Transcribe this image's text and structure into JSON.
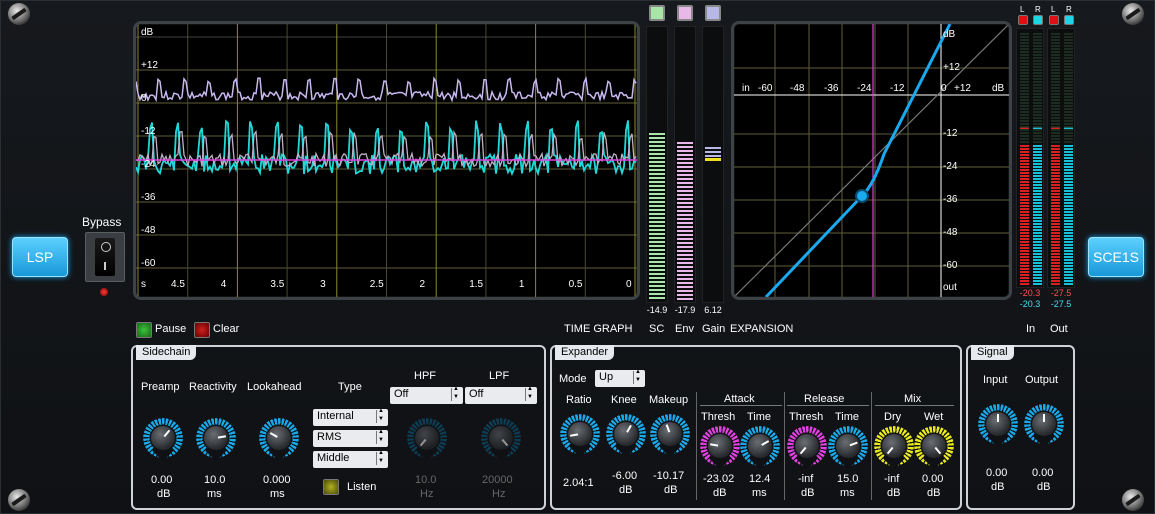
{
  "brand": {
    "lsp_label": "LSP",
    "plugin_label": "SCE1S"
  },
  "bypass": {
    "label": "Bypass"
  },
  "time_graph": {
    "y_ticks": [
      "dB",
      "+12",
      "0",
      "-12",
      "-24",
      "-36",
      "-48",
      "-60"
    ],
    "x_ticks": [
      "s",
      "4.5",
      "4",
      "3.5",
      "3",
      "2.5",
      "2",
      "1.5",
      "1",
      "0.5",
      "0"
    ],
    "pause_label": "Pause",
    "clear_label": "Clear",
    "caption": "TIME GRAPH"
  },
  "meters": {
    "sc": {
      "label": "SC",
      "value": "-14.9",
      "color": "#a8e6a8",
      "level": 0.61
    },
    "env": {
      "label": "Env",
      "value": "-17.9",
      "color": "#e8b8e8",
      "level": 0.58
    },
    "gain": {
      "label": "Gain",
      "value": "6.12",
      "color": "#b8b8e8",
      "level": 0.05
    }
  },
  "expansion_graph": {
    "caption": "EXPANSION",
    "x_ticks": [
      "in",
      "-60",
      "-48",
      "-36",
      "-24",
      "-12",
      "0",
      "+12",
      "dB"
    ],
    "y_ticks": [
      "dB",
      "+12",
      "-12",
      "-24",
      "-36",
      "-48",
      "-60",
      "out"
    ]
  },
  "io_meters": {
    "in": {
      "label": "In",
      "ch_l": "L",
      "ch_r": "R",
      "val_l": "-20.3",
      "val_r": "-20.3"
    },
    "out": {
      "label": "Out",
      "ch_l": "L",
      "ch_r": "R",
      "val_l": "-27.5",
      "val_r": "-27.5"
    }
  },
  "sidechain": {
    "title": "Sidechain",
    "preamp": {
      "label": "Preamp",
      "value": "0.00",
      "unit": "dB"
    },
    "reactivity": {
      "label": "Reactivity",
      "value": "10.0",
      "unit": "ms"
    },
    "lookahead": {
      "label": "Lookahead",
      "value": "0.000",
      "unit": "ms"
    },
    "type": {
      "label": "Type",
      "source": "Internal",
      "mode": "RMS",
      "channel": "Middle"
    },
    "listen_label": "Listen",
    "hpf": {
      "label": "HPF",
      "selected": "Off",
      "value": "10.0",
      "unit": "Hz"
    },
    "lpf": {
      "label": "LPF",
      "selected": "Off",
      "value": "20000",
      "unit": "Hz"
    }
  },
  "expander": {
    "title": "Expander",
    "mode_label": "Mode",
    "mode_value": "Up",
    "ratio": {
      "label": "Ratio",
      "value": "2.04:1"
    },
    "knee": {
      "label": "Knee",
      "value": "-6.00",
      "unit": "dB"
    },
    "makeup": {
      "label": "Makeup",
      "value": "-10.17",
      "unit": "dB"
    },
    "attack": {
      "label": "Attack",
      "thresh_label": "Thresh",
      "time_label": "Time",
      "thresh_value": "-23.02",
      "thresh_unit": "dB",
      "time_value": "12.4",
      "time_unit": "ms"
    },
    "release": {
      "label": "Release",
      "thresh_label": "Thresh",
      "time_label": "Time",
      "thresh_value": "-inf",
      "thresh_unit": "dB",
      "time_value": "15.0",
      "time_unit": "ms"
    },
    "mix": {
      "label": "Mix",
      "dry_label": "Dry",
      "wet_label": "Wet",
      "dry_value": "-inf",
      "dry_unit": "dB",
      "wet_value": "0.00",
      "wet_unit": "dB"
    }
  },
  "signal": {
    "title": "Signal",
    "input": {
      "label": "Input",
      "value": "0.00",
      "unit": "dB"
    },
    "output": {
      "label": "Output",
      "value": "0.00",
      "unit": "dB"
    }
  },
  "colors": {
    "accent": "#1aa8ee",
    "knob_blue": "#19a9ea",
    "knob_magenta": "#e040e0",
    "knob_yellow": "#e8e820"
  }
}
